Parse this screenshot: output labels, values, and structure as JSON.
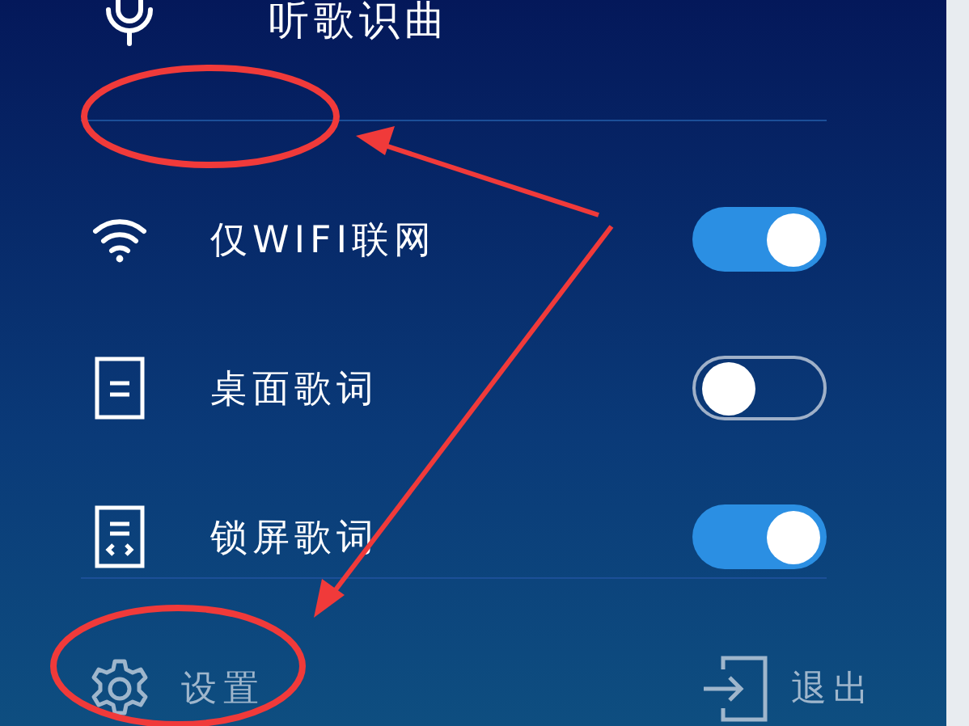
{
  "top_item": {
    "label": "听歌识曲"
  },
  "toggles": [
    {
      "kind": "wifi",
      "label": "仅WIFI联网",
      "on": true
    },
    {
      "kind": "document",
      "label": "桌面歌词",
      "on": false
    },
    {
      "kind": "code-document",
      "label": "锁屏歌词",
      "on": true
    }
  ],
  "footer": {
    "settings": "设置",
    "exit": "退出"
  }
}
